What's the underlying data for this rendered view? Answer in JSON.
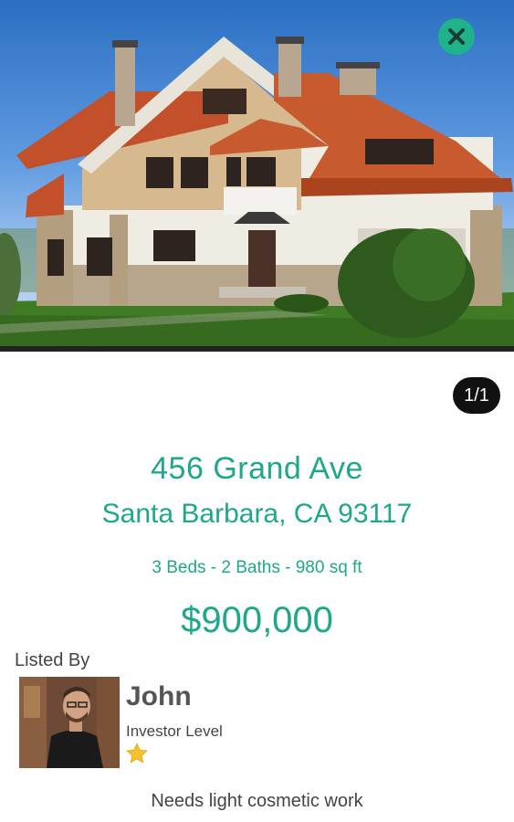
{
  "photo": {
    "alt": "house-photo"
  },
  "gallery": {
    "counter": "1/1"
  },
  "listing": {
    "street": "456 Grand Ave",
    "city_line": "Santa Barbara, CA 93117",
    "specs": "3 Beds - 2 Baths - 980 sq ft",
    "price": "$900,000",
    "note": "Needs light cosmetic work"
  },
  "agent": {
    "listed_by_label": "Listed By",
    "name": "John",
    "level": "Investor Level",
    "stars": 1
  },
  "colors": {
    "accent": "#1ea88a",
    "close_button": "#1fb38c",
    "star": "#f7c230"
  },
  "icons": {
    "close": "close-icon",
    "star": "star-icon"
  }
}
